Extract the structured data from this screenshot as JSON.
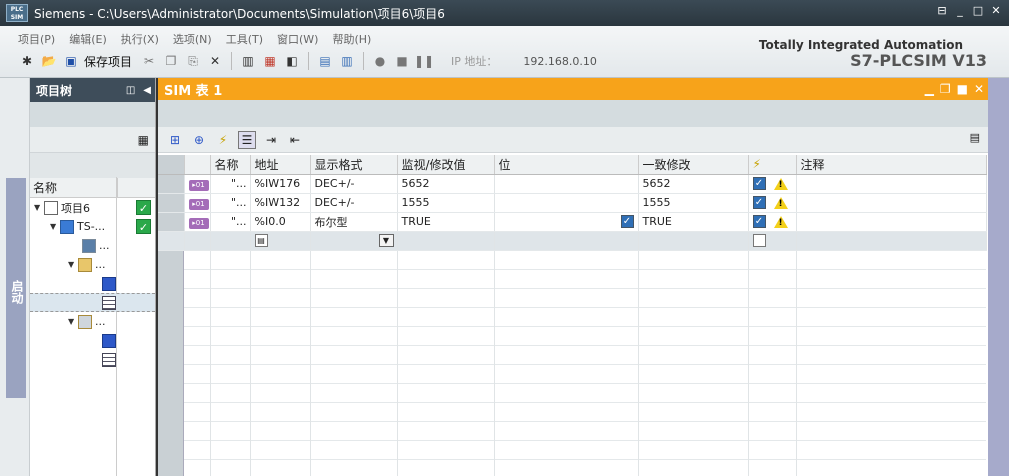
{
  "titlebar": {
    "logo": "PLC SIM",
    "title": "Siemens   -   C:\\Users\\Administrator\\Documents\\Simulation\\项目6\\项目6",
    "controls": [
      "⊟",
      "_",
      "□",
      "✕"
    ]
  },
  "menubar": {
    "items": [
      "项目(P)",
      "编辑(E)",
      "执行(X)",
      "选项(N)",
      "工具(T)",
      "窗口(W)",
      "帮助(H)"
    ]
  },
  "toolbar": {
    "save_label": "保存项目",
    "ip_label": "IP 地址：",
    "ip_value": "192.168.0.10"
  },
  "branding": {
    "line1": "Totally Integrated Automation",
    "line2": "S7-PLCSIM V13"
  },
  "side_tab": {
    "label": "启动"
  },
  "project_tree": {
    "title": "项目树",
    "column_header": "名称",
    "items": [
      {
        "label": "项目6",
        "checked": true
      },
      {
        "label": "TS-...",
        "checked": true
      },
      {
        "label": "..."
      },
      {
        "label": "..."
      },
      {
        "label": ""
      },
      {
        "label": ""
      },
      {
        "label": "..."
      },
      {
        "label": ""
      },
      {
        "label": ""
      }
    ]
  },
  "sim_table": {
    "title": "SIM 表 1",
    "columns": [
      "名称",
      "地址",
      "显示格式",
      "监视/修改值",
      "位",
      "一致修改",
      "⚡",
      "注释"
    ],
    "rows": [
      {
        "name": "\"...",
        "address": "%IW176",
        "format": "DEC+/-",
        "value": "5652",
        "bit_checked": false,
        "consistent": "5652",
        "enabled": true,
        "warning": true,
        "comment": ""
      },
      {
        "name": "\"...",
        "address": "%IW132",
        "format": "DEC+/-",
        "value": "1555",
        "bit_checked": false,
        "consistent": "1555",
        "enabled": true,
        "warning": true,
        "comment": ""
      },
      {
        "name": "\"...",
        "address": "%I0.0",
        "format": "布尔型",
        "value": "TRUE",
        "bit_checked": true,
        "consistent": "TRUE",
        "enabled": true,
        "warning": true,
        "comment": ""
      }
    ]
  },
  "colors": {
    "sim_header": "#f7a31a",
    "tree_header": "#3e4d5a",
    "status_check": "#2aa84a",
    "tag_icon": "#a46cb8"
  }
}
